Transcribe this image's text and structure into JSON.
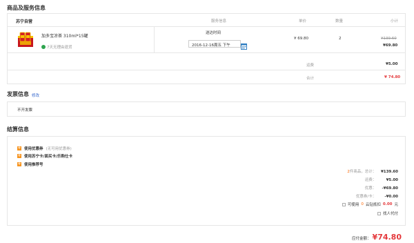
{
  "goods": {
    "title": "商品及服务信息",
    "header": {
      "seller": "苏宁自营",
      "service": "服务信息",
      "price": "单价",
      "qty": "数量",
      "subtotal": "小计"
    },
    "item": {
      "name": "加多宝凉茶 310ml*15罐",
      "return_policy": "7天无理由退货",
      "delivery_label": "送达时间",
      "delivery_value": "2016-12-16周五 下午",
      "price": "¥ 69.80",
      "qty": "2",
      "original_subtotal": "¥139.60",
      "subtotal": "¥69.80"
    },
    "shipping_label": "运费",
    "shipping_value": "¥5.00",
    "total_label": "合计",
    "total_value": "¥ 74.80"
  },
  "invoice": {
    "title": "发票信息",
    "edit": "修改",
    "value": "不开发票"
  },
  "settlement": {
    "title": "结算信息",
    "options": [
      {
        "label": "使用优惠券",
        "note": "(无可用优惠券)"
      },
      {
        "label": "使用苏宁卡/面买卡/乐购仕卡",
        "note": ""
      },
      {
        "label": "使用推荐号",
        "note": ""
      }
    ],
    "summary": {
      "count": "2",
      "goods_label": "件商品，总计：",
      "goods_value": "¥139.60",
      "shipping_label": "运费：",
      "shipping_value": "¥5.00",
      "discount_label": "优惠：",
      "discount_value": "-¥69.80",
      "coupon_label": "优惠券/卡：",
      "coupon_value": "-¥0.00",
      "cloud_prefix": "可使用",
      "cloud_count": "0",
      "cloud_mid": "云钻抵扣",
      "cloud_value": "0.00",
      "cloud_suffix": "元",
      "proxy_label": "找人代付"
    }
  },
  "payable": {
    "label": "应付金额：",
    "value": "¥74.80"
  },
  "colors": {
    "accent": "#e4393c",
    "orange": "#ff6600",
    "link": "#3366cc",
    "product_red": "#c8161d"
  }
}
